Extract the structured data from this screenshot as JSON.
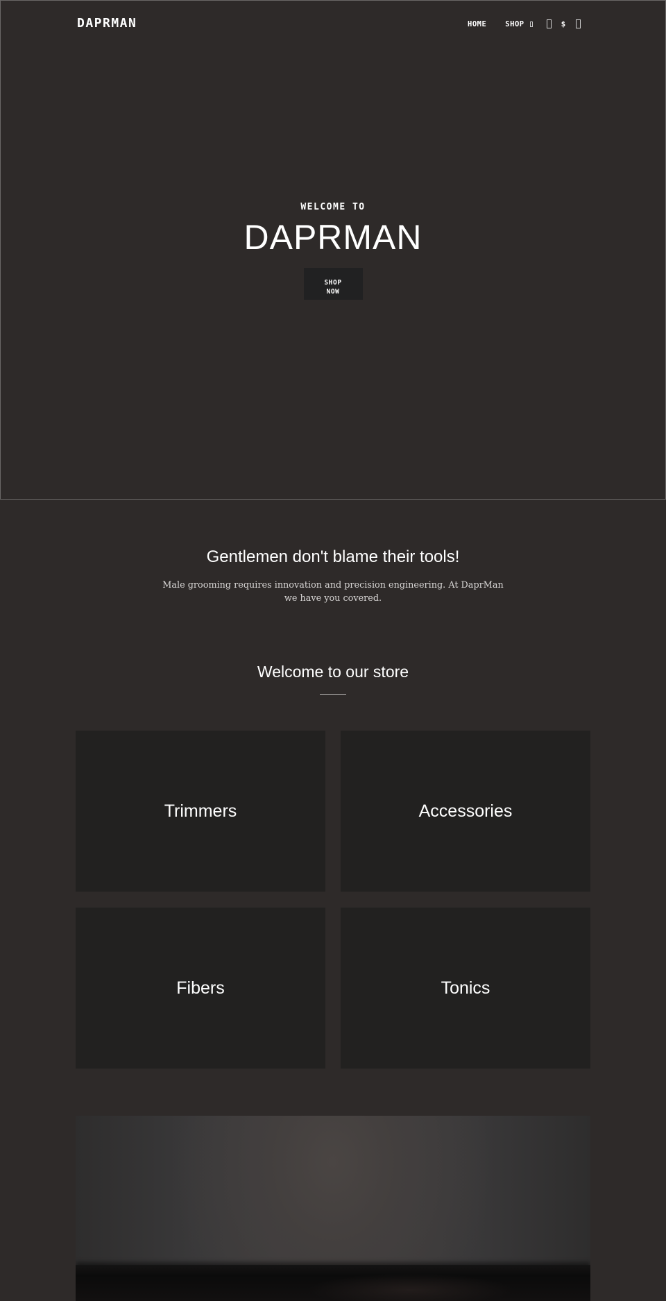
{
  "header": {
    "logo": "DAPRMAN",
    "nav": {
      "home": "HOME",
      "shop": "SHOP",
      "shop_dropdown_icon": "chevron-down-icon",
      "search_icon": "search-icon",
      "currency": "$",
      "cart_icon": "cart-icon"
    }
  },
  "hero": {
    "kicker": "WELCOME TO",
    "title": "DAPRMAN",
    "button_label": "SHOP NOW",
    "button_line1": "SHOP",
    "button_line2": "NOW"
  },
  "intro": {
    "title": "Gentlemen don't blame their tools!",
    "text": "Male grooming requires innovation and precision engineering. At DaprMan we have you covered."
  },
  "store": {
    "title": "Welcome to our store",
    "collections": [
      {
        "label": "Trimmers"
      },
      {
        "label": "Accessories"
      },
      {
        "label": "Fibers"
      },
      {
        "label": "Tonics"
      }
    ]
  },
  "feature": {
    "image": "blurred-spotlit-wall-photo"
  },
  "colors": {
    "page_background": "#2e2a29",
    "tile_background": "#222120",
    "button_background": "#212122",
    "text": "#ffffff",
    "muted_text": "#d8d6d5",
    "hero_border": "#6a6766"
  }
}
